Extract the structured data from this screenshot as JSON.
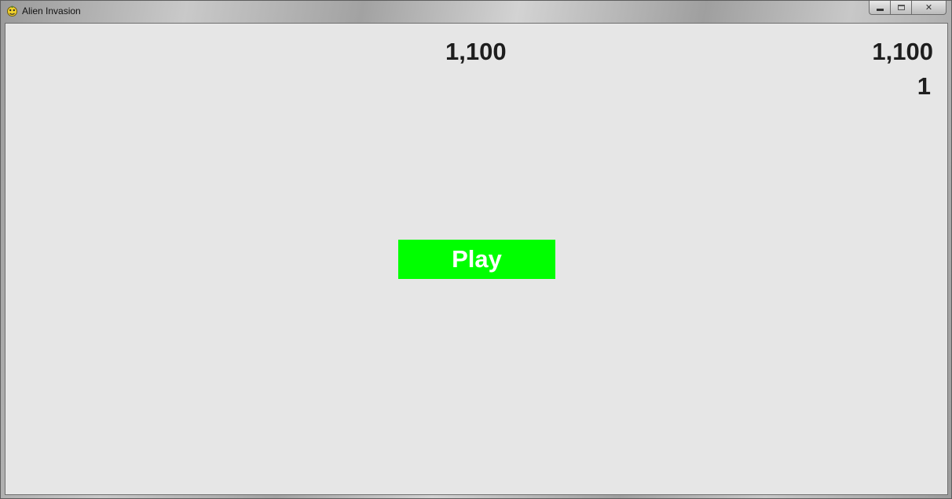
{
  "window": {
    "title": "Alien Invasion",
    "app_icon": "pygame-snake-icon",
    "controls": {
      "minimize": "minimize-icon",
      "maximize": "maximize-icon",
      "close": "close-icon",
      "close_glyph": "✕"
    }
  },
  "game": {
    "score": "1,100",
    "high_score": "1,100",
    "level": "1",
    "play_button_label": "Play"
  },
  "colors": {
    "background": "#e6e6e6",
    "text": "#1e1e1e",
    "play_button": "#00ff00",
    "play_text": "#ffffff"
  }
}
